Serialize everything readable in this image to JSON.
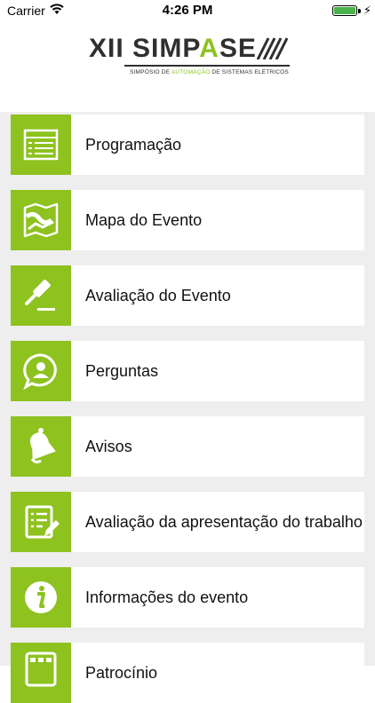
{
  "status_bar": {
    "carrier": "Carrier",
    "time": "4:26 PM",
    "battery_color": "#49b24a"
  },
  "logo": {
    "prefix": "XII ",
    "name_part1": "SIMP",
    "name_part2": "A",
    "name_part3": "SE",
    "subtitle_part1": "SIMPÓSIO DE ",
    "subtitle_part2": "AUTOMAÇÃO",
    "subtitle_part3": " DE SISTEMAS ELÉTRICOS",
    "accent_color": "#8dc21f"
  },
  "menu": {
    "accent_color": "#8dc21f",
    "items": [
      {
        "label": "Programação",
        "icon": "list-icon"
      },
      {
        "label": "Mapa do Evento",
        "icon": "map-icon"
      },
      {
        "label": "Avaliação do Evento",
        "icon": "gavel-icon"
      },
      {
        "label": "Perguntas",
        "icon": "question-chat-icon"
      },
      {
        "label": "Avisos",
        "icon": "bell-icon"
      },
      {
        "label": "Avaliação da apresentação do trabalho",
        "icon": "edit-document-icon"
      },
      {
        "label": "Informações do evento",
        "icon": "info-icon"
      },
      {
        "label": "Patrocínio",
        "icon": "grid-icon"
      }
    ]
  }
}
